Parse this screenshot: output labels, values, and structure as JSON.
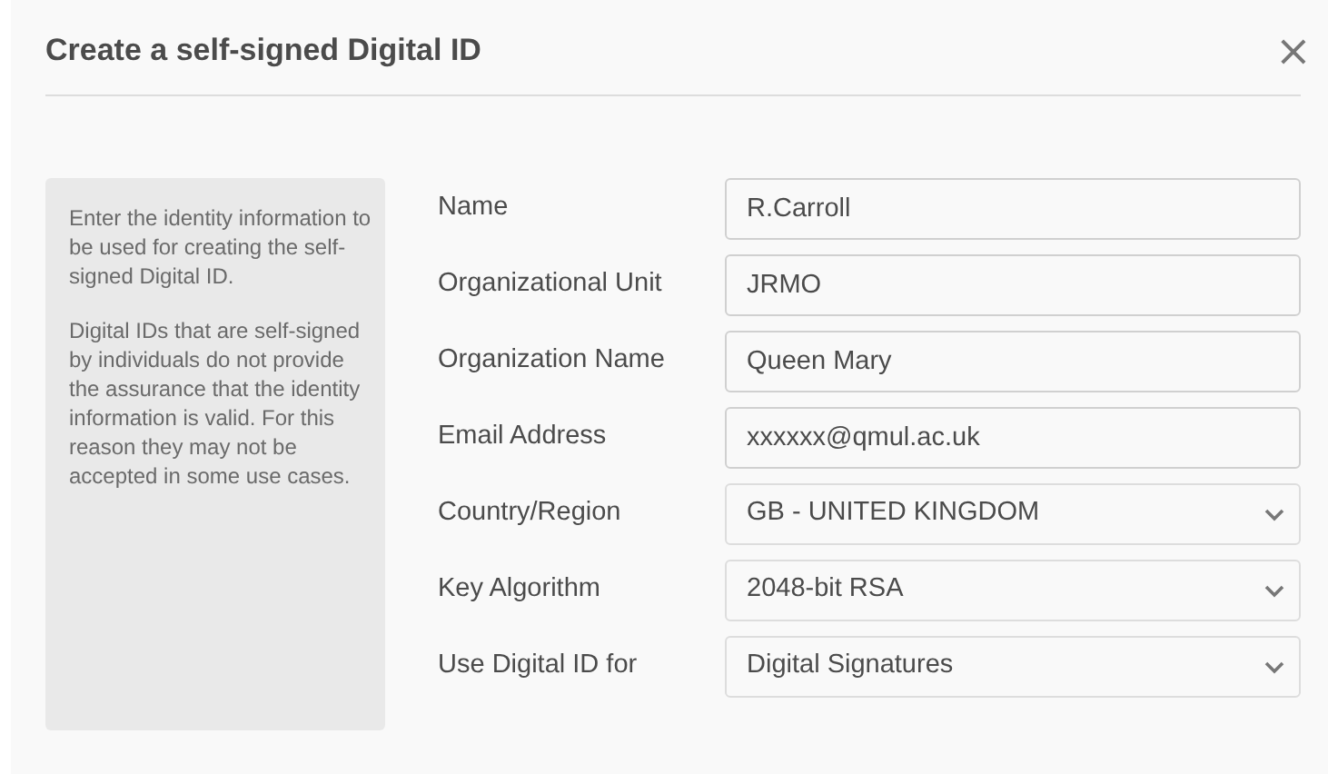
{
  "dialog": {
    "title": "Create a self-signed Digital ID",
    "close": "×"
  },
  "info": [
    "Enter the identity information to be used for creating the self-signed Digital ID.",
    "Digital IDs that are self-signed by individuals do not provide the assurance that the identity information is valid. For this reason they may not be accepted in some use cases."
  ],
  "fields": [
    {
      "label": "Name",
      "value": "R.Carroll",
      "kind": "text"
    },
    {
      "label": "Organizational Unit",
      "value": "JRMO",
      "kind": "text"
    },
    {
      "label": "Organization Name",
      "value": "Queen Mary",
      "kind": "text"
    },
    {
      "label": "Email Address",
      "value": "xxxxxx@qmul.ac.uk",
      "kind": "text"
    },
    {
      "label": "Country/Region",
      "value": "GB - UNITED KINGDOM",
      "kind": "select"
    },
    {
      "label": "Key Algorithm",
      "value": "2048-bit RSA",
      "kind": "select"
    },
    {
      "label": "Use Digital ID for",
      "value": "Digital Signatures",
      "kind": "select"
    }
  ]
}
